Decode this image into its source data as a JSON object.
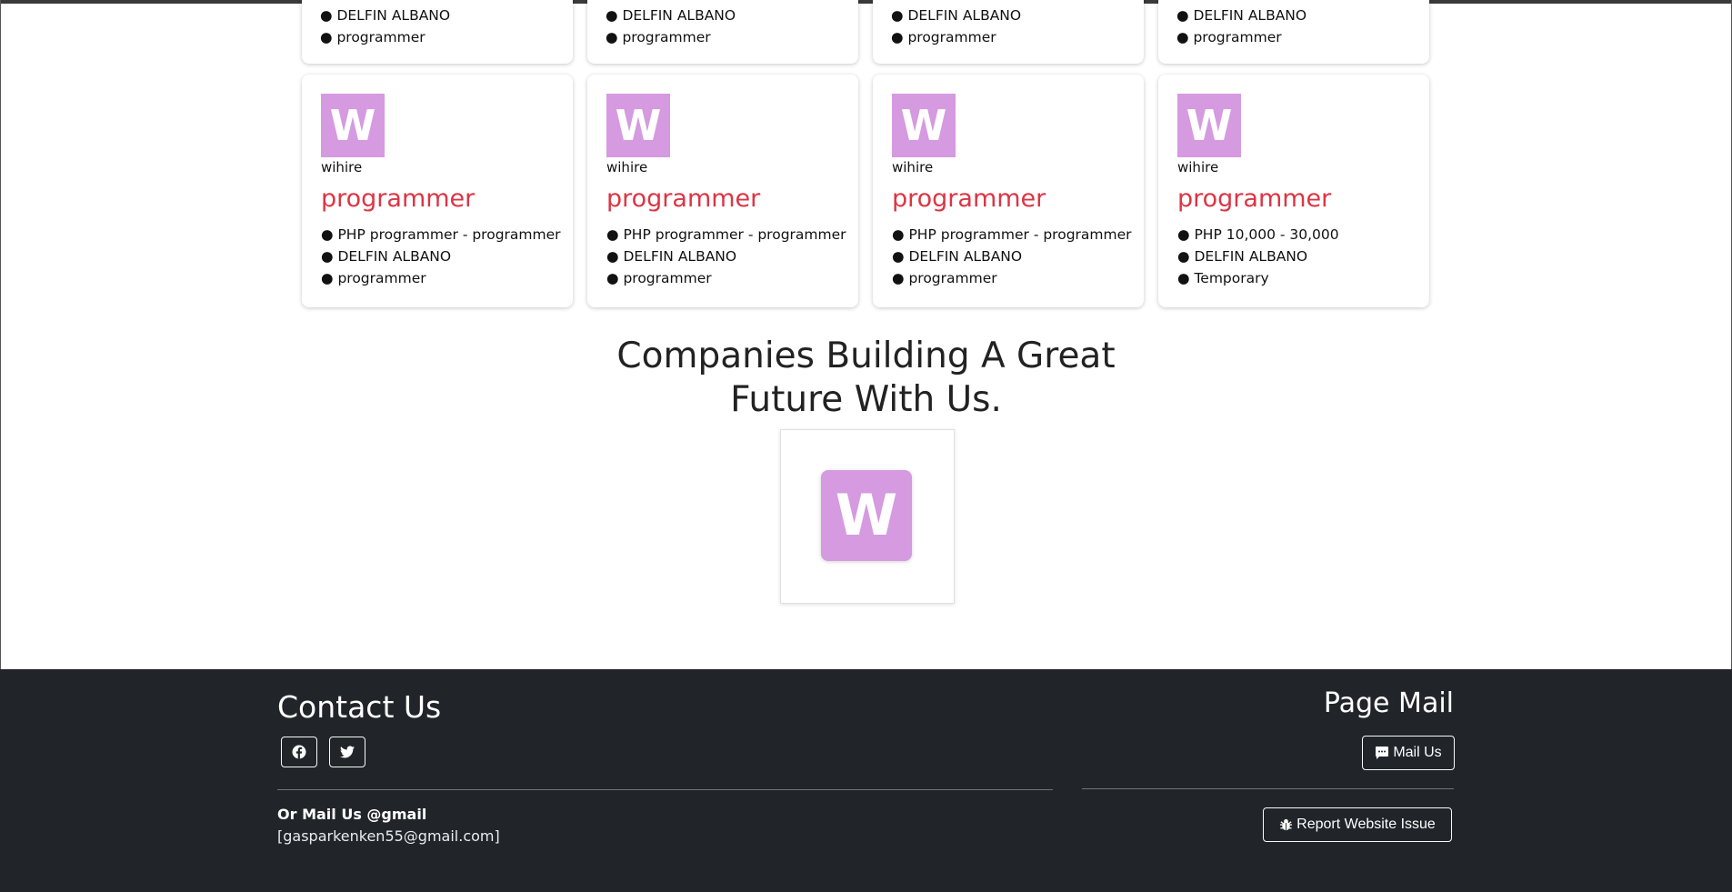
{
  "top_cards": [
    {
      "lines": [
        "● DELFIN ALBANO",
        "● programmer"
      ]
    },
    {
      "lines": [
        "● DELFIN ALBANO",
        "● programmer"
      ]
    },
    {
      "lines": [
        "● DELFIN ALBANO",
        "● programmer"
      ]
    },
    {
      "lines": [
        "● DELFIN ALBANO",
        "● programmer"
      ]
    }
  ],
  "job_cards": [
    {
      "logo_letter": "W",
      "company": "wihire",
      "title": "programmer",
      "details": [
        "● PHP programmer - programmer",
        "● DELFIN ALBANO",
        "● programmer"
      ]
    },
    {
      "logo_letter": "W",
      "company": "wihire",
      "title": "programmer",
      "details": [
        "● PHP programmer - programmer",
        "● DELFIN ALBANO",
        "● programmer"
      ]
    },
    {
      "logo_letter": "W",
      "company": "wihire",
      "title": "programmer",
      "details": [
        "● PHP programmer - programmer",
        "● DELFIN ALBANO",
        "● programmer"
      ]
    },
    {
      "logo_letter": "W",
      "company": "wihire",
      "title": "programmer",
      "details": [
        "● PHP 10,000 - 30,000",
        "● DELFIN ALBANO",
        "● Temporary"
      ]
    }
  ],
  "companies_section": {
    "title_line1": "Companies Building A Great",
    "title_line2": "Future With Us.",
    "logo_letter": "W"
  },
  "footer": {
    "contact_title": "Contact Us",
    "mail_label": "Or Mail Us @gmail",
    "mail_address": "[gasparkenken55@gmail.com]",
    "page_mail_title": "Page Mail",
    "mail_button": "Mail Us",
    "report_button": "Report Website Issue",
    "social_icons": [
      "facebook-icon",
      "twitter-icon"
    ]
  },
  "colors": {
    "logo_bg": "#d59ae0",
    "job_title": "#dc3545",
    "footer_bg": "#212529"
  }
}
